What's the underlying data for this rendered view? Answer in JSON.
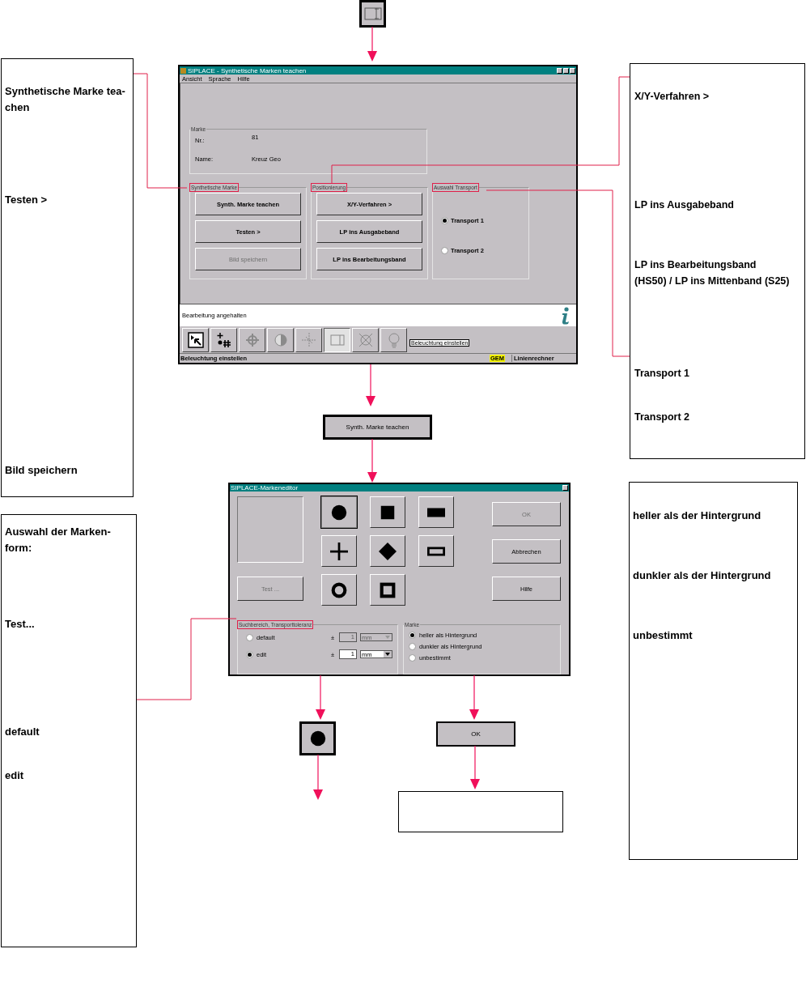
{
  "main_window": {
    "title": "SIPLACE - Synthetische Marken teachen",
    "menu": [
      "Ansicht",
      "Sprache",
      "Hilfe"
    ],
    "marke_group": {
      "label": "Marke",
      "fields": [
        {
          "label": "Nr.:",
          "value": "81"
        },
        {
          "label": "Name:",
          "value": "Kreuz Geo"
        }
      ]
    },
    "groups": [
      {
        "label": "Synthetische Marke",
        "highlighted": true,
        "items": [
          {
            "kind": "button",
            "label": "Synth. Marke teachen",
            "disabled": false
          },
          {
            "kind": "button",
            "label": "Testen >",
            "disabled": false
          },
          {
            "kind": "button",
            "label": "Bild speichern",
            "disabled": true
          }
        ]
      },
      {
        "label": "Positionierung",
        "highlighted": true,
        "items": [
          {
            "kind": "button",
            "label": "X/Y-Verfahren >",
            "disabled": false
          },
          {
            "kind": "button",
            "label": "LP ins Ausgabeband",
            "disabled": false
          },
          {
            "kind": "button",
            "label": "LP ins Bearbeitungsband",
            "disabled": false
          }
        ]
      },
      {
        "label": "Auswahl Transport",
        "highlighted": true,
        "items": [
          {
            "kind": "radio",
            "label": "Transport 1",
            "selected": true
          },
          {
            "kind": "radio",
            "label": "Transport 2",
            "selected": false
          }
        ]
      }
    ],
    "message": "Bearbeitung angehalten",
    "toolbar": [
      {
        "kind": "pointer",
        "disabled": false,
        "selected": false
      },
      {
        "kind": "grid",
        "disabled": false,
        "selected": false
      },
      {
        "kind": "crosshair",
        "disabled": true,
        "selected": false
      },
      {
        "kind": "shade",
        "disabled": true,
        "selected": false
      },
      {
        "kind": "axes",
        "disabled": true,
        "selected": false
      },
      {
        "kind": "frame",
        "disabled": true,
        "selected": true
      },
      {
        "kind": "cross",
        "disabled": true,
        "selected": false
      },
      {
        "kind": "bulb",
        "disabled": true,
        "selected": false
      }
    ],
    "tooltip": "Beleuchtung einstellen",
    "status_bar": {
      "text": "Beleuchtung einstellen",
      "badge": "GEM",
      "computer": "Linienrechner"
    }
  },
  "flow_button": "Synth. Marke teachen",
  "editor_window": {
    "title": "SIPLACE-Markeneditor",
    "shapes": [
      {
        "kind": "circle",
        "selected": true
      },
      {
        "kind": "square",
        "selected": false
      },
      {
        "kind": "bar",
        "selected": false
      },
      {
        "kind": "plus",
        "selected": false
      },
      {
        "kind": "diamond",
        "selected": false
      },
      {
        "kind": "frame",
        "selected": false
      },
      {
        "kind": "ring",
        "selected": false
      },
      {
        "kind": "square_frame",
        "selected": false
      }
    ],
    "test_button": {
      "label": "Test ...",
      "disabled": true
    },
    "buttons": [
      {
        "label": "OK",
        "disabled": true
      },
      {
        "label": "Abbrechen",
        "disabled": false
      },
      {
        "label": "Hilfe",
        "disabled": false
      }
    ],
    "search_group": {
      "label": "Suchbereich, Transporttoleranz",
      "highlighted": true,
      "options": [
        {
          "label": "default",
          "selected": false,
          "sign": "±",
          "value": "1",
          "unit": "mm",
          "disabled": true
        },
        {
          "label": "edit",
          "selected": true,
          "sign": "±",
          "value": "1",
          "unit": "mm",
          "disabled": false
        }
      ]
    },
    "marke_group": {
      "label": "Marke",
      "highlighted": false,
      "options": [
        {
          "label": "heller als Hintergrund",
          "selected": true
        },
        {
          "label": "dunkler als Hintergrund",
          "selected": false
        },
        {
          "label": "unbestimmt",
          "selected": false
        }
      ]
    }
  },
  "result_shape": {
    "kind": "circle"
  },
  "ok_box": "OK",
  "notes": [
    {
      "items": [
        "Synthetische Marke tea-\nchen",
        "Testen >",
        "Bild speichern"
      ]
    },
    {
      "items": [
        "X/Y-Verfahren >",
        "LP ins Ausgabeband",
        "LP ins Bearbeitungsband\n(HS50) / LP ins Mittenband (S25)",
        "Transport 1",
        "Transport 2"
      ]
    },
    {
      "items": [
        "heller als der Hintergrund",
        "dunkler als der Hintergrund",
        "unbestimmt"
      ]
    },
    {
      "items": [
        "Auswahl der Marken-\nform:",
        "Test...",
        "default",
        "edit"
      ]
    }
  ]
}
